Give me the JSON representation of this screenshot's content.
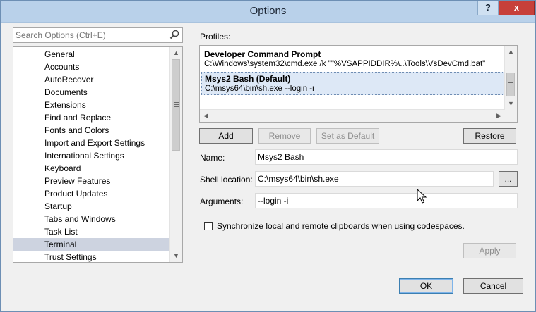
{
  "window": {
    "title": "Options",
    "help_label": "?",
    "close_label": "x"
  },
  "search": {
    "placeholder": "Search Options (Ctrl+E)"
  },
  "tree": {
    "items": [
      {
        "label": "General"
      },
      {
        "label": "Accounts"
      },
      {
        "label": "AutoRecover"
      },
      {
        "label": "Documents"
      },
      {
        "label": "Extensions"
      },
      {
        "label": "Find and Replace"
      },
      {
        "label": "Fonts and Colors"
      },
      {
        "label": "Import and Export Settings"
      },
      {
        "label": "International Settings"
      },
      {
        "label": "Keyboard"
      },
      {
        "label": "Preview Features"
      },
      {
        "label": "Product Updates"
      },
      {
        "label": "Startup"
      },
      {
        "label": "Tabs and Windows"
      },
      {
        "label": "Task List"
      },
      {
        "label": "Terminal"
      },
      {
        "label": "Trust Settings"
      }
    ],
    "selected": "Terminal"
  },
  "profiles": {
    "label": "Profiles:",
    "items": [
      {
        "name": "Developer Command Prompt",
        "command": "C:\\Windows\\system32\\cmd.exe /k \"\"%VSAPPIDDIR%\\..\\Tools\\VsDevCmd.bat\""
      },
      {
        "name": "Msys2 Bash (Default)",
        "command": "C:\\msys64\\bin\\sh.exe --login -i"
      }
    ],
    "selected_index": 1
  },
  "buttons": {
    "add": "Add",
    "remove": "Remove",
    "set_default": "Set as Default",
    "restore": "Restore",
    "browse": "...",
    "apply": "Apply",
    "ok": "OK",
    "cancel": "Cancel"
  },
  "form": {
    "name_label": "Name:",
    "name_value": "Msys2 Bash",
    "shell_label": "Shell location:",
    "shell_value": "C:\\msys64\\bin\\sh.exe",
    "args_label": "Arguments:",
    "args_value": "--login -i"
  },
  "sync": {
    "label": "Synchronize local and remote clipboards when using codespaces.",
    "checked": false
  },
  "colors": {
    "titlebar": "#b9d1ea",
    "close": "#c7403a",
    "selection": "#cdd3e0",
    "accent": "#3c7fb1"
  },
  "icons": [
    "search-icon",
    "scroll-up-icon",
    "scroll-down-icon",
    "scroll-left-icon",
    "scroll-right-icon",
    "mouse-cursor-icon"
  ]
}
